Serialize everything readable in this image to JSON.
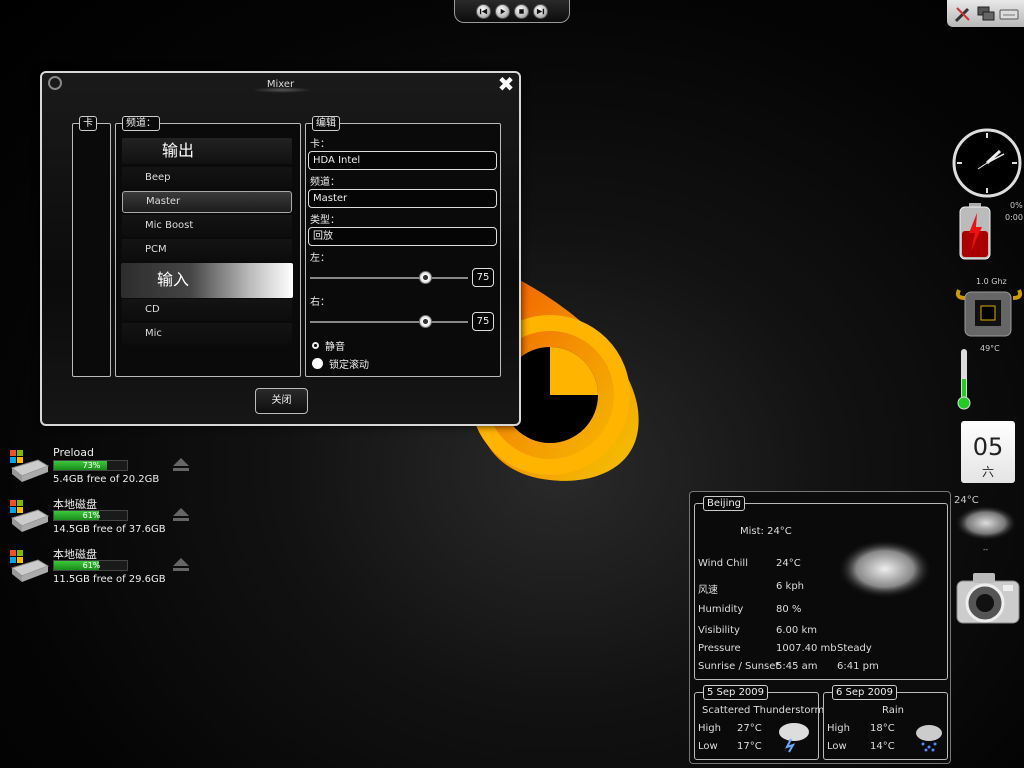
{
  "media_bar": {
    "buttons": [
      "previous-icon",
      "play-icon",
      "stop-icon",
      "next-icon"
    ]
  },
  "tray": {
    "icons": [
      "tools-icon",
      "network-icon",
      "keyboard-icon"
    ]
  },
  "mixer": {
    "title": "Mixer",
    "close_symbol": "✖",
    "card_group_label": "卡",
    "channel_group_label": "频道：",
    "output_header": "输出",
    "output_channels": [
      "Beep",
      "Master",
      "Mic Boost",
      "PCM"
    ],
    "selected_channel": "Master",
    "input_header": "输入",
    "input_channels": [
      "CD",
      "Mic"
    ],
    "edit": {
      "group_label": "编辑",
      "card_label": "卡：",
      "card_value": "HDA Intel",
      "channel_label": "频道：",
      "channel_value": "Master",
      "type_label": "类型：",
      "type_value": "回放",
      "left_label": "左：",
      "left_value": "75",
      "right_label": "右：",
      "right_value": "75",
      "mute_label": "静音",
      "lock_label": "锁定滚动"
    },
    "close_button": "关闭"
  },
  "drives": [
    {
      "name": "Preload",
      "percent": "73%",
      "fill": 73,
      "free": "5.4GB free of 20.2GB"
    },
    {
      "name": "本地磁盘",
      "percent": "61%",
      "fill": 61,
      "free": "14.5GB free of 37.6GB"
    },
    {
      "name": "本地磁盘",
      "percent": "61%",
      "fill": 61,
      "free": "11.5GB free of 29.6GB"
    }
  ],
  "weather": {
    "city": "Beijing",
    "condition": "Mist: 24°C",
    "rows": [
      {
        "label": "Wind Chill",
        "value": "24°C"
      },
      {
        "label": "风速",
        "value": "6 kph"
      },
      {
        "label": "Humidity",
        "value": "80 %"
      },
      {
        "label": "Visibility",
        "value": "6.00 km"
      },
      {
        "label": "Pressure",
        "value": "1007.40 mb",
        "extra": "Steady"
      },
      {
        "label": "Sunrise / Sunset",
        "value": "5:45 am",
        "extra": "6:41 pm"
      }
    ],
    "forecast": [
      {
        "date": "5 Sep 2009",
        "condition": "Scattered Thunderstorms",
        "high_label": "High",
        "high": "27°C",
        "low_label": "Low",
        "low": "17°C"
      },
      {
        "date": "6 Sep 2009",
        "condition": "Rain",
        "high_label": "High",
        "high": "18°C",
        "low_label": "Low",
        "low": "14°C"
      }
    ]
  },
  "gadgets": {
    "battery_percent": "0%",
    "battery_time": "0:00",
    "cpu_freq": "1.0 Ghz",
    "cpu_temp": "49°C",
    "calendar_day": "05",
    "calendar_weekday": "六",
    "mini_weather_temp": "24°C",
    "mini_weather_sep": "--"
  }
}
